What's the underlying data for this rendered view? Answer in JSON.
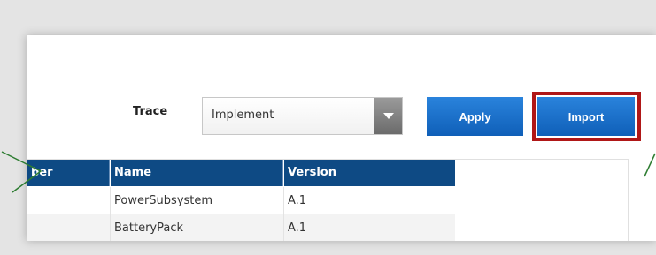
{
  "trace": {
    "label": "Trace",
    "selected": "Implement"
  },
  "buttons": {
    "apply": "Apply",
    "import": "Import"
  },
  "table": {
    "columns": [
      "ber",
      "Name",
      "Version"
    ],
    "rows": [
      {
        "name": "PowerSubsystem",
        "version": "A.1"
      },
      {
        "name": "BatteryPack",
        "version": "A.1"
      }
    ]
  },
  "colors": {
    "header_bg": "#0e4a84",
    "button_bg": "#1670cf",
    "highlight_border": "#b01717",
    "arrow": "#2e7d32"
  }
}
